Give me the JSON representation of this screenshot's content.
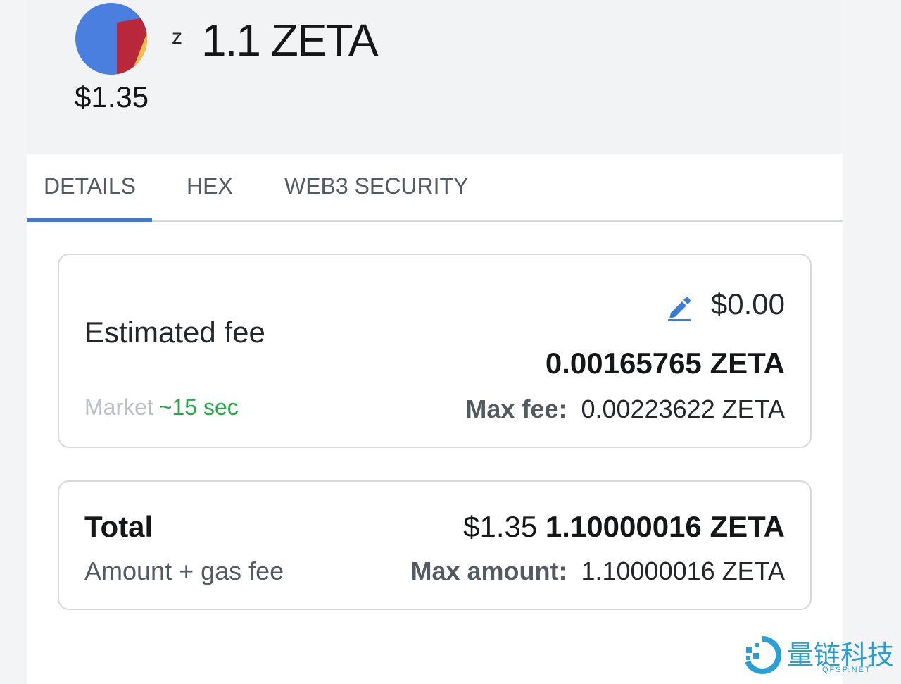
{
  "header": {
    "token_prefix": "z",
    "token_amount": "1.1 ZETA",
    "fiat_value": "$1.35"
  },
  "tabs": [
    {
      "label": "DETAILS",
      "active": true
    },
    {
      "label": "HEX",
      "active": false
    },
    {
      "label": "WEB3 SECURITY",
      "active": false
    }
  ],
  "fee": {
    "label": "Estimated fee",
    "fiat": "$0.00",
    "token": "0.00165765 ZETA",
    "market_label": "Market",
    "market_time": "~15 sec",
    "max_fee_label": "Max fee:",
    "max_fee_value": "0.00223622 ZETA",
    "edit_icon": "pencil-icon"
  },
  "total": {
    "label": "Total",
    "sub_label": "Amount + gas fee",
    "fiat": "$1.35",
    "token": "1.10000016 ZETA",
    "max_amount_label": "Max amount:",
    "max_amount_value": "1.10000016 ZETA"
  },
  "brand": {
    "name": "量链科技",
    "url": "QFSP.NET"
  },
  "colors": {
    "accent": "#3a7bd5",
    "market_time": "#28a745",
    "brand": "#2a9fd6"
  }
}
